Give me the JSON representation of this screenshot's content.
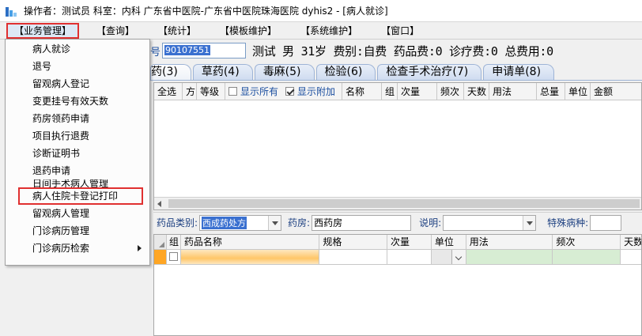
{
  "window": {
    "title": "操作者：测试员  科室：内科  广东省中医院-广东省中医院珠海医院 dyhis2 - [病人就诊]"
  },
  "menubar": {
    "items": [
      "【业务管理】",
      "【查询】",
      "【统计】",
      "【模板维护】",
      "【系统维护】",
      "【窗口】"
    ]
  },
  "dropdown": {
    "items": [
      "病人就诊",
      "退号",
      "留观病人登记",
      "变更挂号有效天数",
      "药房领药申请",
      "项目执行退费",
      "诊断证明书",
      "退药申请",
      "日间手术病人管理",
      "病人住院卡登记打印",
      "留观病人管理",
      "门诊病历管理",
      "门诊病历检索"
    ]
  },
  "patient": {
    "card_label": "号",
    "card_no": "90107551",
    "summary": "测试 男 31岁 费别:自费 药品费:0 诊疗费:0 总费用:0"
  },
  "tabs": [
    "药(3)",
    "草药(4)",
    "毒麻(5)",
    "检验(6)",
    "检查手术治疗(7)",
    "申请单(8)"
  ],
  "grid1": {
    "columns": [
      "全选",
      "方",
      "等级",
      "显示所有",
      "显示附加",
      "名称",
      "组",
      "次量",
      "频次",
      "天数",
      "用法",
      "总量",
      "单位",
      "金额"
    ]
  },
  "filter": {
    "drug_type_label": "药品类别:",
    "drug_type_value": "西成药处方",
    "pharmacy_label": "药房:",
    "pharmacy_value": "西药房",
    "note_label": "说明:",
    "note_value": "",
    "disease_label": "特殊病种:",
    "disease_value": ""
  },
  "grid2": {
    "columns": [
      "组",
      "药品名称",
      "规格",
      "次量",
      "单位",
      "用法",
      "频次",
      "天数"
    ]
  },
  "colors": {
    "highlight_border": "#e03030",
    "row_indicator": "#ffa624",
    "selection_blue": "#3a70d0"
  }
}
